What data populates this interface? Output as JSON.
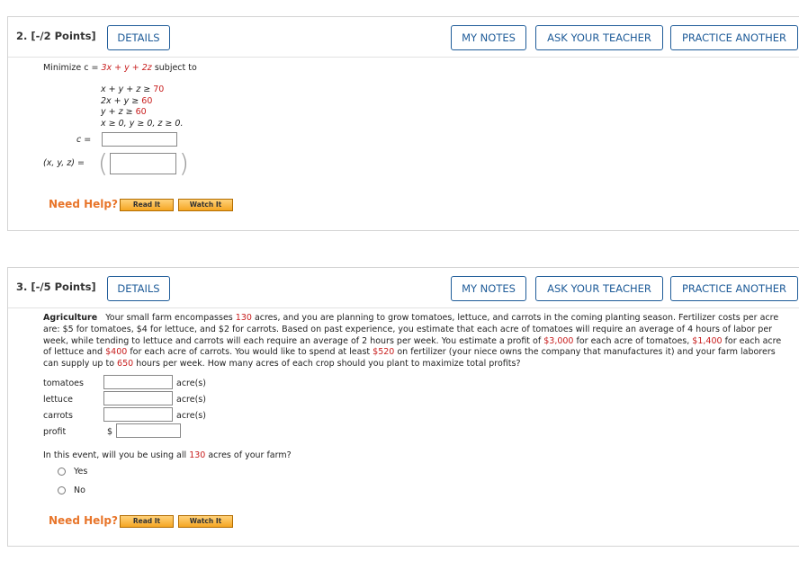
{
  "q2": {
    "number": "2. [-/2 Points]",
    "details": "DETAILS",
    "my_notes": "MY NOTES",
    "ask_teacher": "ASK YOUR TEACHER",
    "practice": "PRACTICE ANOTHER",
    "objective_prefix": "Minimize c = ",
    "objective_expr": "3x + y + 2z",
    "objective_suffix": " subject to",
    "constraints": [
      {
        "lhs": "x + y + z ≥ ",
        "rhs": "70"
      },
      {
        "lhs": "2x + y ≥ ",
        "rhs": "60"
      },
      {
        "lhs": "y + z ≥ ",
        "rhs": "60"
      },
      {
        "lhs": "x ≥ 0, y ≥ 0, z ≥ 0.",
        "rhs": ""
      }
    ],
    "c_label": "c =",
    "xyz_label": "(x, y, z) =",
    "c_value": "",
    "xyz_value": "",
    "need_help": "Need Help?",
    "read_it": "Read It",
    "watch_it": "Watch It"
  },
  "q3": {
    "number": "3. [-/5 Points]",
    "details": "DETAILS",
    "my_notes": "MY NOTES",
    "ask_teacher": "ASK YOUR TEACHER",
    "practice": "PRACTICE ANOTHER",
    "title": "Agriculture",
    "p1": "Your small farm encompasses ",
    "acres": "130",
    "p2": " acres, and you are planning to grow tomatoes, lettuce, and carrots in the coming planting season. Fertilizer costs per acre are: $5 for tomatoes, $4 for lettuce, and $2 for carrots. Based on past experience, you estimate that each acre of tomatoes will require an average of 4 hours of labor per week, while tending to lettuce and carrots will each require an average of 2 hours per week. You estimate a profit of ",
    "profit_tomatoes": "$3,000",
    "p3": " for each acre of tomatoes, ",
    "profit_lettuce": "$1,400",
    "p4": " for each acre of lettuce and ",
    "profit_carrots": "$400",
    "p5": " for each acre of carrots. You would like to spend at least ",
    "fertilizer_min": "$520",
    "p6": " on fertilizer (your niece owns the company that manufactures it) and your farm laborers can supply up to ",
    "labor_hours": "650",
    "p7": " hours per week. How many acres of each crop should you plant to maximize total profits?",
    "rows": [
      {
        "label": "tomatoes",
        "unit": "acre(s)",
        "value": ""
      },
      {
        "label": "lettuce",
        "unit": "acre(s)",
        "value": ""
      },
      {
        "label": "carrots",
        "unit": "acre(s)",
        "value": ""
      }
    ],
    "profit_label": "profit",
    "dollar": "$",
    "profit_value": "",
    "event_q1": "In this event, will you be using all ",
    "event_acres": "130",
    "event_q2": " acres of your farm?",
    "opt_yes": "Yes",
    "opt_no": "No",
    "need_help": "Need Help?",
    "read_it": "Read It",
    "watch_it": "Watch It"
  }
}
